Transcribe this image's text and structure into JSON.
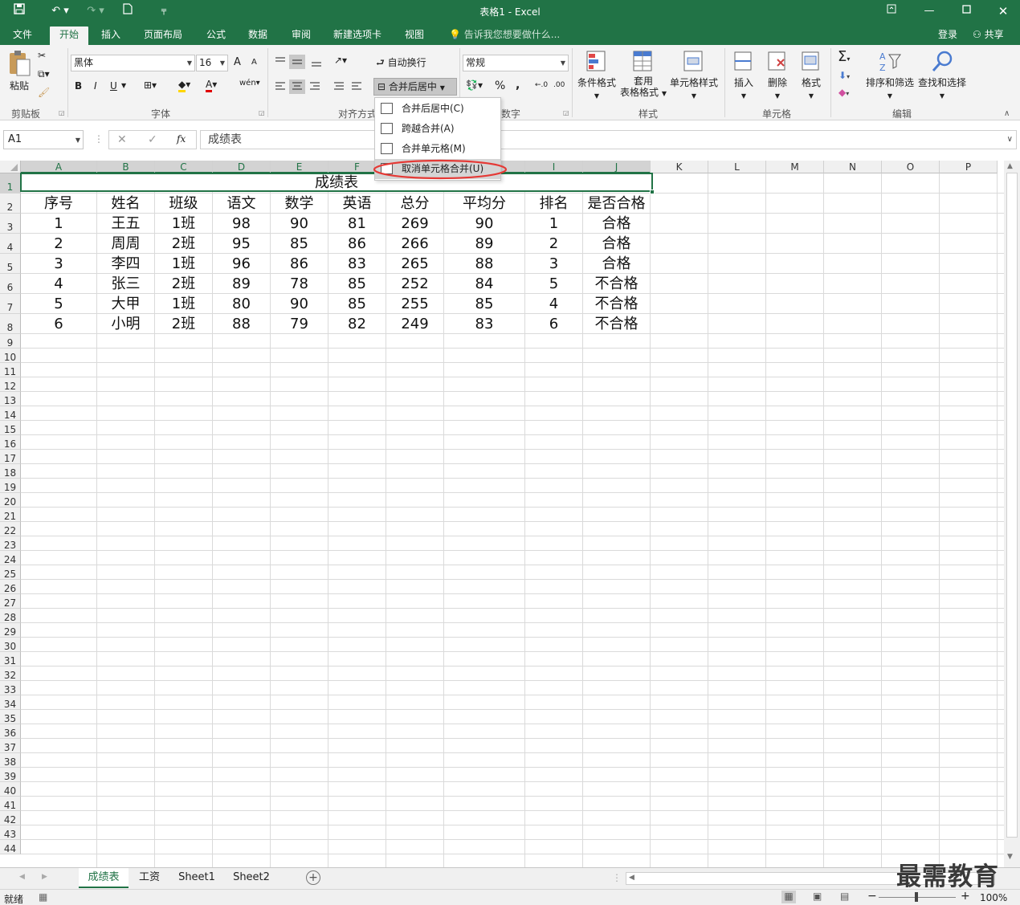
{
  "window": {
    "title": "表格1 - Excel"
  },
  "tabs": [
    "文件",
    "开始",
    "插入",
    "页面布局",
    "公式",
    "数据",
    "审阅",
    "新建选项卡",
    "视图"
  ],
  "tell_me": "告诉我您想要做什么...",
  "account": {
    "login": "登录",
    "share": "共享"
  },
  "ribbon": {
    "clipboard": {
      "paste": "粘贴",
      "label": "剪贴板"
    },
    "font": {
      "name": "黑体",
      "size": "16",
      "label": "字体",
      "bold": "B",
      "italic": "I",
      "underline": "U",
      "grow": "A",
      "shrink": "A",
      "color_a": "A",
      "wen": "wén"
    },
    "alignment": {
      "wrap": "自动换行",
      "merge": "合并后居中",
      "label": "对齐方式"
    },
    "number": {
      "format": "常规",
      "label": "数字",
      "percent": "%",
      "comma": ","
    },
    "styles": {
      "conditional": "条件格式",
      "table1": "套用",
      "table2": "表格格式",
      "cell_styles": "单元格样式",
      "label": "样式"
    },
    "cells": {
      "insert": "插入",
      "delete": "删除",
      "format": "格式",
      "label": "单元格"
    },
    "editing": {
      "sort": "排序和筛选",
      "find": "查找和选择",
      "label": "编辑"
    }
  },
  "merge_menu": {
    "items": [
      "合并后居中(C)",
      "跨越合并(A)",
      "合并单元格(M)",
      "取消单元格合并(U)"
    ]
  },
  "formula_bar": {
    "name_box": "A1",
    "fx": "fx",
    "value": "成绩表"
  },
  "sheet": {
    "columns": [
      "A",
      "B",
      "C",
      "D",
      "E",
      "F",
      "G",
      "H",
      "I",
      "J",
      "K",
      "L",
      "M",
      "N",
      "O",
      "P"
    ],
    "row_numbers": [
      "1",
      "2",
      "3",
      "4",
      "5",
      "6",
      "7",
      "8",
      "9",
      "10",
      "11",
      "12",
      "13",
      "14",
      "15",
      "16",
      "17",
      "18",
      "19",
      "20",
      "21",
      "22",
      "23",
      "24",
      "25",
      "26",
      "27",
      "28",
      "29",
      "30",
      "31",
      "32",
      "33",
      "34",
      "35",
      "36",
      "37",
      "38",
      "39",
      "40",
      "41",
      "42",
      "43",
      "44"
    ],
    "title": "成绩表",
    "headers": [
      "序号",
      "姓名",
      "班级",
      "语文",
      "数学",
      "英语",
      "总分",
      "平均分",
      "排名",
      "是否合格"
    ],
    "rows": [
      [
        "1",
        "王五",
        "1班",
        "98",
        "90",
        "81",
        "269",
        "90",
        "1",
        "合格"
      ],
      [
        "2",
        "周周",
        "2班",
        "95",
        "85",
        "86",
        "266",
        "89",
        "2",
        "合格"
      ],
      [
        "3",
        "李四",
        "1班",
        "96",
        "86",
        "83",
        "265",
        "88",
        "3",
        "合格"
      ],
      [
        "4",
        "张三",
        "2班",
        "89",
        "78",
        "85",
        "252",
        "84",
        "5",
        "不合格"
      ],
      [
        "5",
        "大甲",
        "1班",
        "80",
        "90",
        "85",
        "255",
        "85",
        "4",
        "不合格"
      ],
      [
        "6",
        "小明",
        "2班",
        "88",
        "79",
        "82",
        "249",
        "83",
        "6",
        "不合格"
      ]
    ]
  },
  "sheet_tabs": [
    "成绩表",
    "工资",
    "Sheet1",
    "Sheet2"
  ],
  "status": {
    "ready": "就绪",
    "zoom": "100%"
  },
  "watermark": "最需教育",
  "colors": {
    "accent": "#217346",
    "highlight": "#e53935"
  }
}
